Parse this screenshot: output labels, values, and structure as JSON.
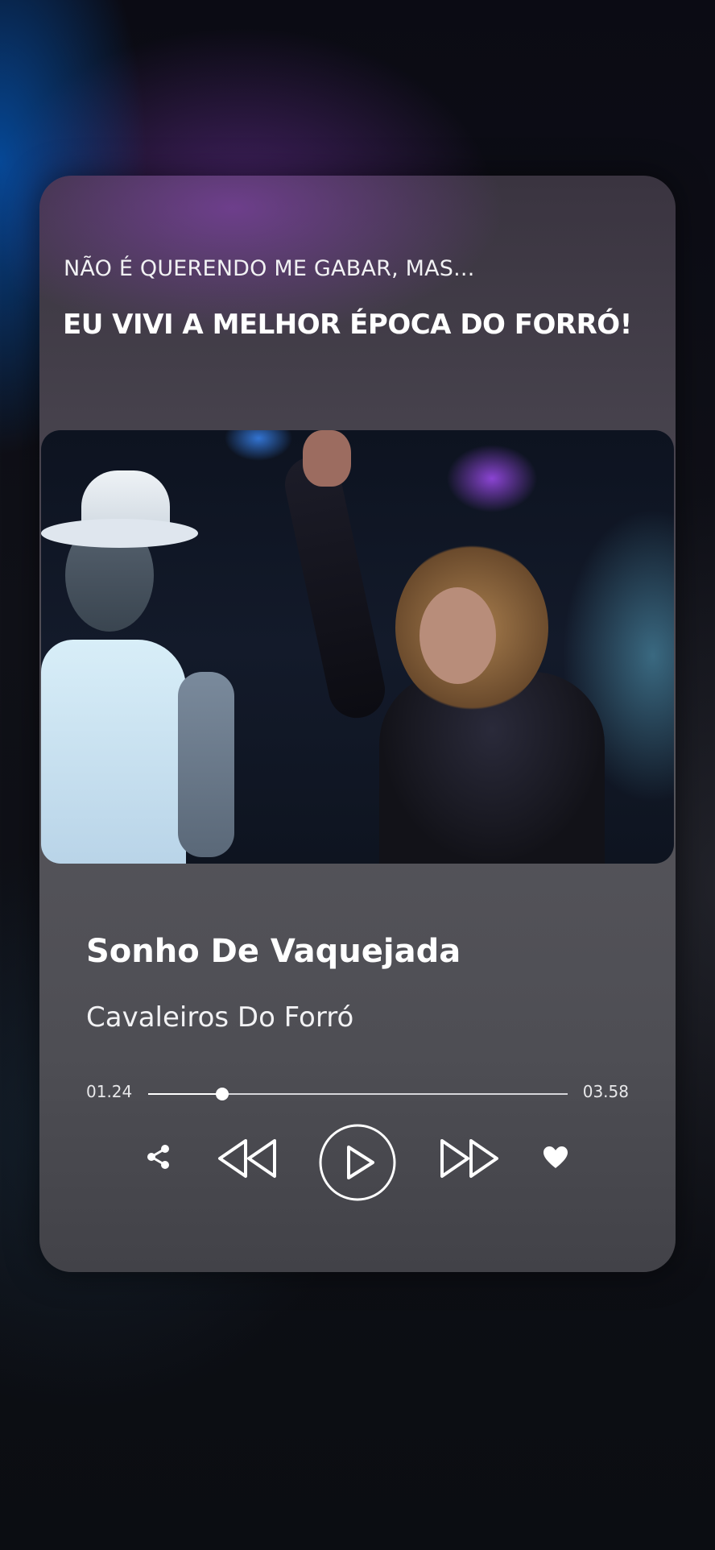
{
  "header": {
    "kicker": "NÃO É QUERENDO ME GABAR, MAS...",
    "headline": "EU VIVI A MELHOR ÉPOCA DO FORRÓ!"
  },
  "player": {
    "track_title": "Sonho De Vaquejada",
    "artist": "Cavaleiros Do Forró",
    "time_current": "01.24",
    "time_total": "03.58",
    "progress": 0.177
  },
  "controls": {
    "share_icon": "share-icon",
    "prev_icon": "rewind-icon",
    "play_icon": "play-icon",
    "next_icon": "fast-forward-icon",
    "like_icon": "heart-icon"
  },
  "colors": {
    "accent": "#ffffff",
    "card_tint": "#4a4650",
    "glow_purple": "#9646c8",
    "glow_blue": "#0078ff"
  }
}
